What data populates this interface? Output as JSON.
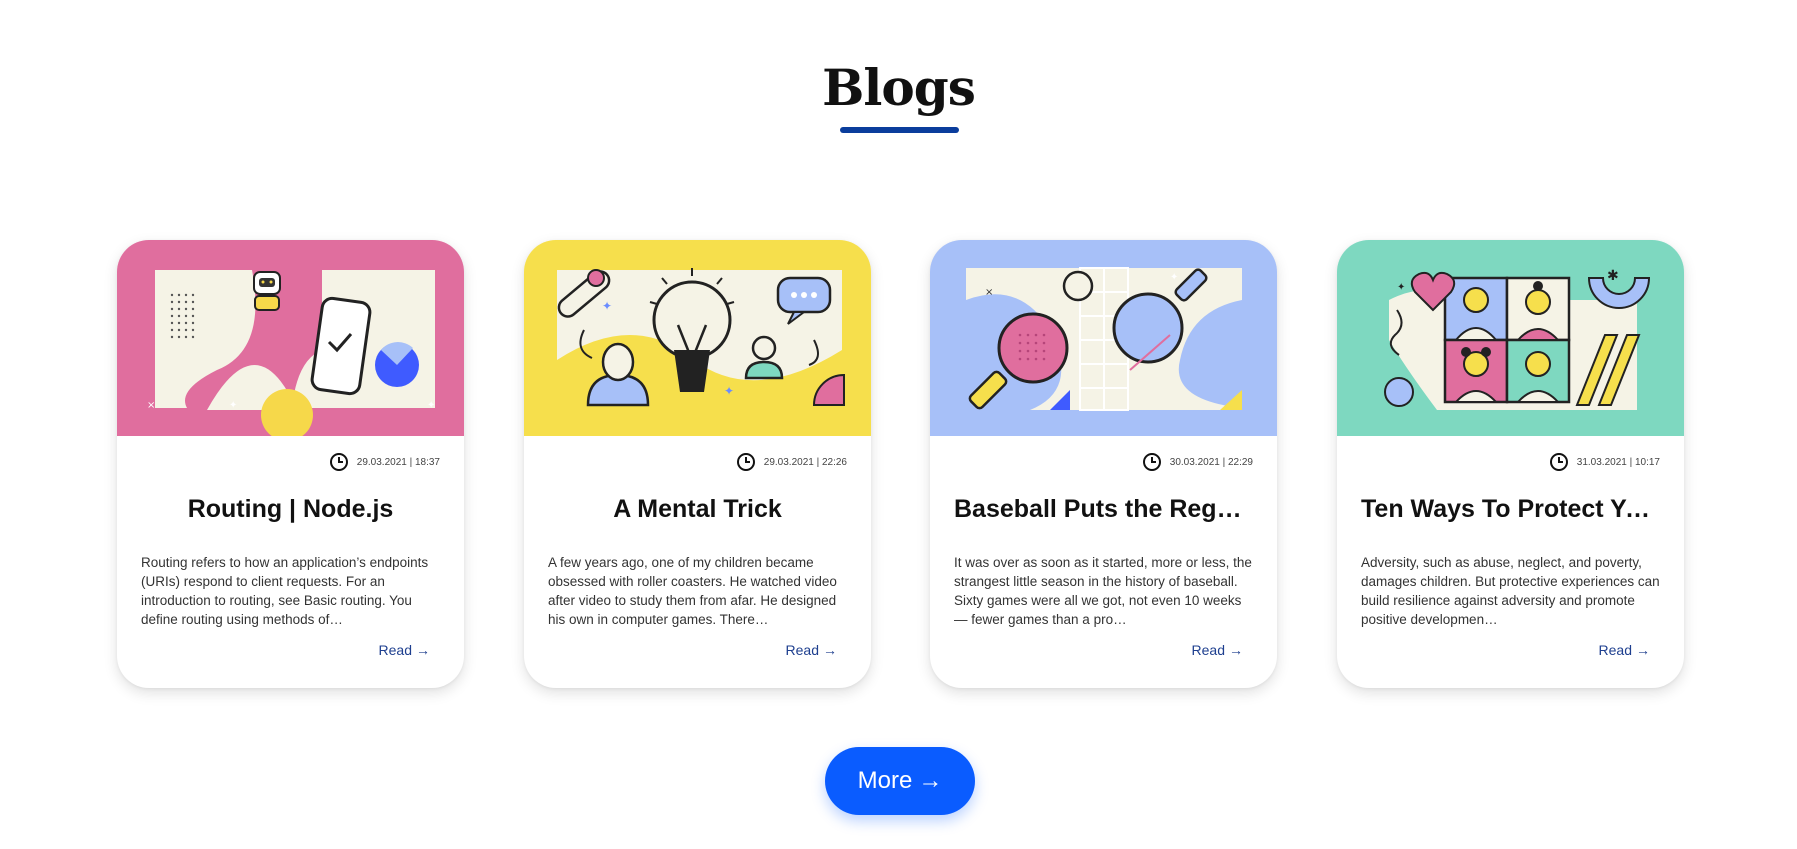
{
  "section": {
    "title": "Blogs"
  },
  "colors": {
    "accent_underline": "#0a3d9c",
    "more_button": "#0a5cff",
    "read_link": "#1e3f8f",
    "card_bg_pink": "#e06e9e",
    "card_bg_yellow": "#f6df4c",
    "card_bg_blue": "#a7c0f8",
    "card_bg_green": "#7ed8c0"
  },
  "posts": [
    {
      "illustration": "robot-phone-checkmark-illustration",
      "date": "29.03.2021 | 18:37",
      "title": "Routing | Node.js",
      "excerpt": "Routing refers to how an application’s endpoints (URIs) respond to client requests. For an introduction to routing, see Basic routing. You define routing using methods of…",
      "read_label": "Read",
      "read_arrow": "→"
    },
    {
      "illustration": "lightbulb-idea-chat-illustration",
      "date": "29.03.2021 | 22:26",
      "title": "A Mental Trick",
      "excerpt": "A few years ago, one of my children became obsessed with roller coasters. He watched video after video to study them from afar. He designed his own in computer games. There…",
      "read_label": "Read",
      "read_arrow": "→"
    },
    {
      "illustration": "ping-pong-paddles-illustration",
      "date": "30.03.2021 | 22:29",
      "title": "Baseball Puts the Regul…",
      "excerpt": "It was over as soon as it started, more or less, the strangest little season in the history of baseball. Sixty games were all we got, not even 10 weeks — fewer games than a pro…",
      "read_label": "Read",
      "read_arrow": "→"
    },
    {
      "illustration": "video-call-faces-heart-illustration",
      "date": "31.03.2021 | 10:17",
      "title": "Ten Ways To Protect Yo…",
      "excerpt": "Adversity, such as abuse, neglect, and poverty, damages children. But protective experiences can build resilience against adversity and promote positive developmen…",
      "read_label": "Read",
      "read_arrow": "→"
    }
  ],
  "more_button": {
    "label": "More",
    "arrow": "→"
  }
}
